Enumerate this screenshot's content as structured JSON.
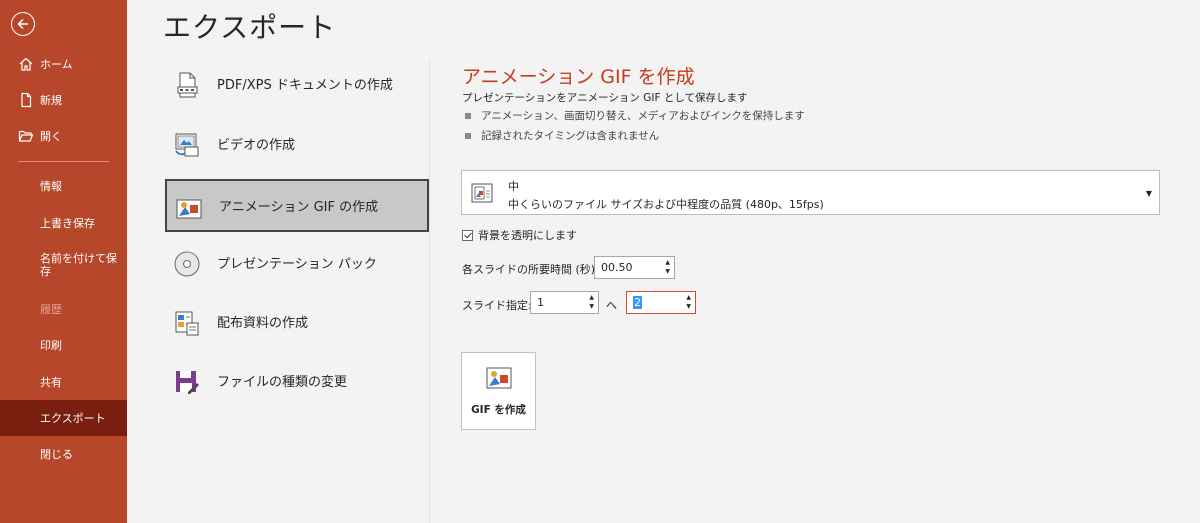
{
  "sidebar": {
    "items": [
      {
        "label": "ホーム"
      },
      {
        "label": "新規"
      },
      {
        "label": "開く"
      },
      {
        "label": "情報"
      },
      {
        "label": "上書き保存"
      },
      {
        "label": "名前を付けて保存"
      },
      {
        "label": "履歴"
      },
      {
        "label": "印刷"
      },
      {
        "label": "共有"
      },
      {
        "label": "エクスポート"
      },
      {
        "label": "閉じる"
      }
    ],
    "active_item": "エクスポート",
    "accent_color": "#b7472a",
    "active_color": "#7a1f10"
  },
  "page": {
    "title": "エクスポート"
  },
  "options": [
    {
      "label": "PDF/XPS ドキュメントの作成",
      "icon": "pdf-document-icon"
    },
    {
      "label": "ビデオの作成",
      "icon": "video-icon"
    },
    {
      "label": "アニメーション GIF の作成",
      "icon": "gif-image-icon"
    },
    {
      "label": "プレゼンテーション パック",
      "icon": "cd-package-icon"
    },
    {
      "label": "配布資料の作成",
      "icon": "handout-icon"
    },
    {
      "label": "ファイルの種類の変更",
      "icon": "save-as-icon"
    }
  ],
  "selected_option": "アニメーション GIF の作成",
  "panel": {
    "title": "アニメーション GIF を作成",
    "subtitle": "プレゼンテーションをアニメーション GIF として保存します",
    "bullets": [
      "アニメーション、画面切り替え、メディアおよびインクを保持します",
      "記録されたタイミングは含まれません"
    ],
    "quality": {
      "name": "中",
      "description": "中くらいのファイル サイズおよび中程度の品質 (480p、15fps)"
    },
    "transparent_background": {
      "label": "背景を透明にします",
      "checked": true
    },
    "seconds_per_slide": {
      "label": "各スライドの所要時間 (秒):",
      "value": "00.50"
    },
    "slide_range": {
      "label": "スライド指定:",
      "from": "1",
      "separator": "へ",
      "to": "2"
    },
    "create_button": "GIF を作成"
  }
}
